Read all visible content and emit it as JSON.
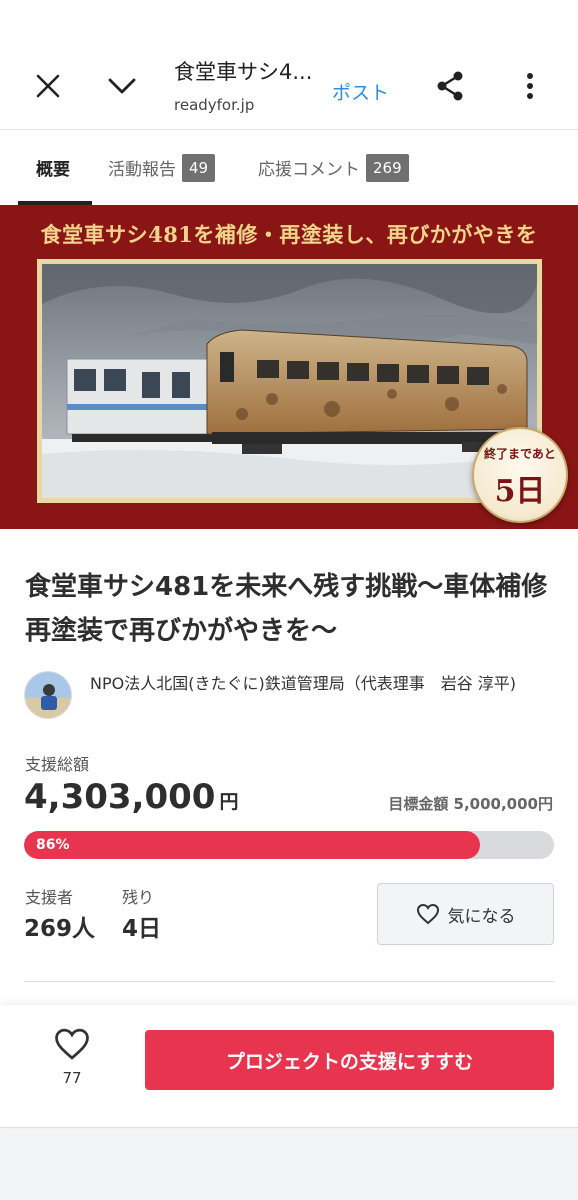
{
  "browser": {
    "page_title": "食堂車サシ4...",
    "url": "readyfor.jp",
    "post_label": "ポスト",
    "icons": [
      "close-icon",
      "chevron-down-icon",
      "share-icon",
      "more-vertical-icon"
    ]
  },
  "tabs": [
    {
      "label": "概要",
      "active": true
    },
    {
      "label": "活動報告",
      "badge": "49"
    },
    {
      "label": "応援コメント",
      "badge": "269"
    }
  ],
  "hero": {
    "caption": "食堂車サシ481を補修・再塗装し、再びかがやきを",
    "badge_top": "終了まであと",
    "badge_days": "5日"
  },
  "project": {
    "title": "食堂車サシ481を未来へ残す挑戦〜車体補修再塗装で再びかがやきを〜",
    "owner": "NPO法人北国(きたぐに)鉄道管理局（代表理事　岩谷 淳平)"
  },
  "funding": {
    "total_label": "支援総額",
    "amount": "4,303,000",
    "currency": "円",
    "goal": "目標金額 5,000,000円",
    "progress_text": "86%",
    "progress_percent": 86,
    "supporters_label": "支援者",
    "supporters": "269人",
    "remaining_label": "残り",
    "remaining": "4日",
    "watch_label": "気になる"
  },
  "actions": {
    "like_count": "77",
    "support_label": "プロジェクトの支援にすすむ"
  },
  "colors": {
    "accent": "#e8354f",
    "hero_bg": "#8a1515",
    "link": "#2f8de4"
  }
}
